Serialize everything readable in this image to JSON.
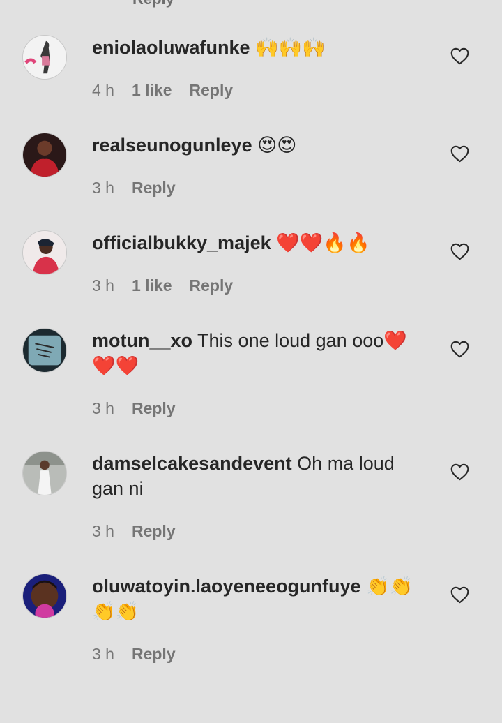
{
  "comments": [
    {
      "username": "eniolaoluwafunke",
      "text": " 🙌🙌🙌",
      "time": "4 h",
      "likes": "1 like",
      "reply": "Reply"
    },
    {
      "username": "realseunogunleye",
      "text": " 😍😍",
      "time": "3 h",
      "likes": "",
      "reply": "Reply"
    },
    {
      "username": "officialbukky_majek",
      "text": " ❤️❤️🔥🔥",
      "time": "3 h",
      "likes": "1 like",
      "reply": "Reply"
    },
    {
      "username": "motun__xo",
      "text": " This one loud gan ooo❤️❤️❤️",
      "time": "3 h",
      "likes": "",
      "reply": "Reply"
    },
    {
      "username": "damselcakesandevent",
      "text": " Oh ma loud gan ni",
      "time": "3 h",
      "likes": "",
      "reply": "Reply"
    },
    {
      "username": "oluwatoyin.laoyeneeogunfuye",
      "text": " 👏👏👏👏",
      "time": "3 h",
      "likes": "",
      "reply": "Reply"
    }
  ],
  "top_peek": "Reply",
  "colors": {
    "background": "#e1e1e1",
    "text": "#262626",
    "meta": "#757575"
  }
}
